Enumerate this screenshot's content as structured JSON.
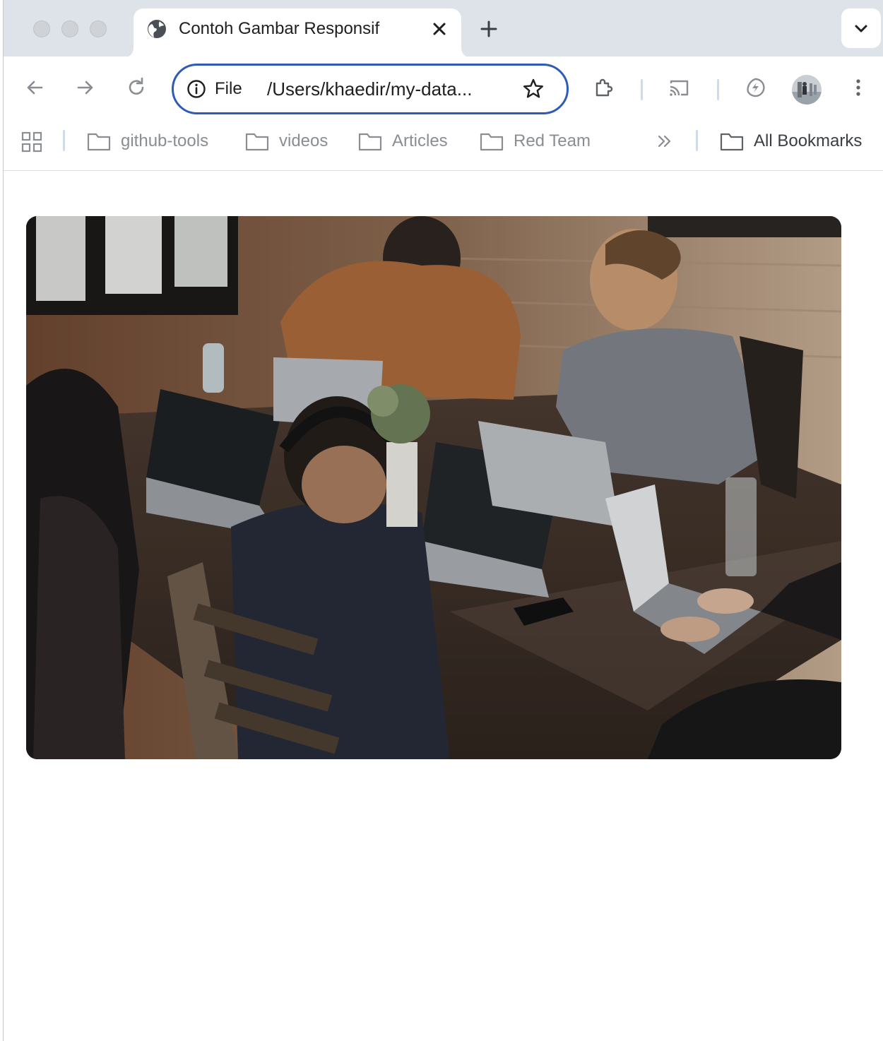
{
  "browser": {
    "tab": {
      "title": "Contoh Gambar Responsif",
      "favicon": "globe-icon",
      "close_icon": "close-icon"
    },
    "new_tab_icon": "plus-icon",
    "tab_search_icon": "chevron-down-icon"
  },
  "toolbar": {
    "back_icon": "arrow-left-icon",
    "forward_icon": "arrow-right-icon",
    "reload_icon": "reload-icon",
    "omnibox": {
      "info_icon": "info-icon",
      "scheme": "File",
      "url": "/Users/khaedir/my-data...",
      "bookmark_icon": "star-icon"
    },
    "extensions_icon": "puzzle-icon",
    "cast_icon": "cast-icon",
    "performance_icon": "energy-saver-icon",
    "menu_icon": "kebab-menu-icon"
  },
  "bookmarks": {
    "apps_icon": "apps-grid-icon",
    "items": [
      {
        "label": "github-tools",
        "icon": "folder-icon"
      },
      {
        "label": "videos",
        "icon": "folder-icon"
      },
      {
        "label": "Articles",
        "icon": "folder-icon"
      },
      {
        "label": "Red Team",
        "icon": "folder-icon"
      }
    ],
    "overflow_icon": "double-chevron-right-icon",
    "all_bookmarks": {
      "label": "All Bookmarks",
      "icon": "folder-icon"
    }
  },
  "page": {
    "image": {
      "kind": "photo",
      "subject": "team working on laptops around a wooden table"
    }
  },
  "colors": {
    "tabstrip_bg": "#dee3e9",
    "omnibox_focus": "#2f5bb7",
    "separator": "#c9dcf7"
  }
}
